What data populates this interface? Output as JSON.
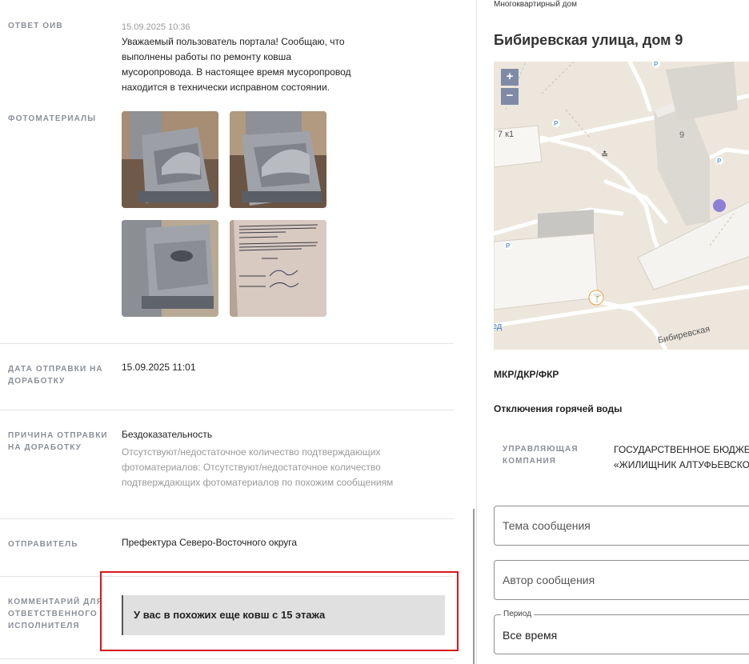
{
  "response": {
    "label": "ОТВЕТ ОИВ",
    "timestamp": "15.09.2025 10:36",
    "lines": [
      "Уважаемый пользователь портала! Сообщаю, что",
      "выполнены работы по ремонту ковша",
      "мусоропровода. В настоящее время мусоропровод",
      "находится в технически исправном состоянии."
    ]
  },
  "photos": {
    "label": "ФОТОМАТЕРИАЛЫ",
    "items": [
      {
        "alt": "garbage-chute-hopper-photo-1"
      },
      {
        "alt": "garbage-chute-hopper-photo-2"
      },
      {
        "alt": "garbage-chute-hopper-photo-3"
      },
      {
        "alt": "signed-work-report-document-photo"
      }
    ]
  },
  "rework_date": {
    "label_lines": [
      "ДАТА ОТПРАВКИ НА",
      "ДОРАБОТКУ"
    ],
    "value": "15.09.2025 11:01"
  },
  "rework_reason": {
    "label_lines": [
      "ПРИЧИНА ОТПРАВКИ",
      "НА ДОРАБОТКУ"
    ],
    "value": "Бездоказательность",
    "details": [
      "Отсутствуют/недостаточное количество подтверждающих",
      "фотоматериалов: Отсутствуют/недостаточное количество",
      "подтверждающих фотоматериалов по похожим сообщениям"
    ]
  },
  "sender": {
    "label": "ОТПРАВИТЕЛЬ",
    "value": "Префектура Северо-Восточного округа"
  },
  "comment": {
    "label_lines": [
      "КОММЕНТАРИЙ ДЛЯ",
      "ОТВЕТСТВЕННОГО",
      "ИСПОЛНИТЕЛЯ"
    ],
    "value": "У вас в похожих еще ковш с 15 этажа"
  },
  "address": {
    "type": "Многоквартирный дом",
    "title": "Бибиревская улица, дом 9"
  },
  "map": {
    "zoom_in": "+",
    "zoom_out": "−",
    "house_7k1": "7 к1",
    "house_9": "9",
    "street": "Бибиревская",
    "edge_label": "ед",
    "parking": "P",
    "marker_color": "#8b7fd6"
  },
  "sections": {
    "mkr": "МКР/ДКР/ФКР",
    "hot_water": "Отключения горячей воды"
  },
  "management": {
    "label_lines": [
      "УПРАВЛЯЮЩАЯ",
      "КОМПАНИЯ"
    ],
    "value_lines": [
      "ГОСУДАРСТВЕННОЕ БЮДЖЕТ",
      "«ЖИЛИЩНИК АЛТУФЬЕВСКО"
    ]
  },
  "filters": {
    "topic_placeholder": "Тема сообщения",
    "author_placeholder": "Автор сообщения",
    "period_label": "Период",
    "period_value": "Все время"
  },
  "colors": {
    "highlight_border": "#d9161e",
    "label_gray": "#8a8f99"
  }
}
